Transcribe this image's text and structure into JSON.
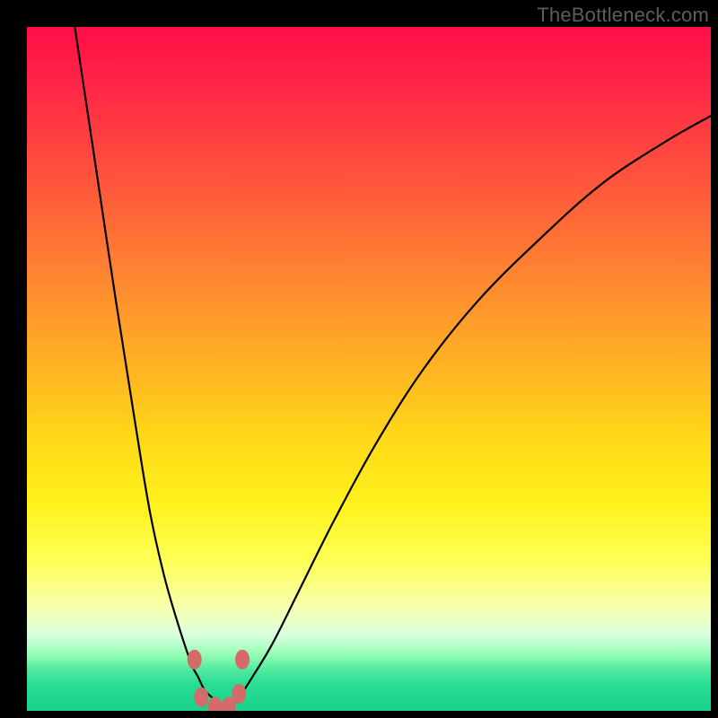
{
  "watermark": "TheBottleneck.com",
  "colors": {
    "frame_background": "#000000",
    "curve_stroke": "#000000",
    "marker_fill": "#d46a6a",
    "gradient_stops": [
      "#ff0e48",
      "#ff2b45",
      "#ff5d3a",
      "#ff8b2f",
      "#ffb422",
      "#ffd818",
      "#fff21d",
      "#ffff55",
      "#f7ffb0",
      "#d8ffe0",
      "#8efcb2",
      "#50eaa0",
      "#2adf93",
      "#1fd88e",
      "#1ad28a"
    ]
  },
  "chart_data": {
    "type": "line",
    "title": "",
    "xlabel": "",
    "ylabel": "",
    "xlim": [
      0,
      100
    ],
    "ylim": [
      0,
      100
    ],
    "grid": false,
    "legend": false,
    "series": [
      {
        "name": "left-branch",
        "x": [
          7,
          10,
          13,
          16,
          18,
          20,
          22,
          24,
          25,
          26,
          27,
          28,
          29
        ],
        "y": [
          100,
          80,
          60,
          41,
          29,
          20,
          13,
          7,
          5,
          3,
          2,
          1,
          0
        ]
      },
      {
        "name": "right-branch",
        "x": [
          29,
          31,
          33,
          36,
          40,
          45,
          51,
          58,
          66,
          75,
          84,
          93,
          100
        ],
        "y": [
          0,
          2,
          5,
          10,
          18,
          28,
          39,
          50,
          60,
          69,
          77,
          83,
          87
        ]
      }
    ],
    "markers": [
      {
        "x": 24.5,
        "y": 7.5
      },
      {
        "x": 25.5,
        "y": 2.0
      },
      {
        "x": 27.5,
        "y": 0.6
      },
      {
        "x": 29.5,
        "y": 0.6
      },
      {
        "x": 31.0,
        "y": 2.5
      },
      {
        "x": 31.5,
        "y": 7.5
      }
    ]
  }
}
